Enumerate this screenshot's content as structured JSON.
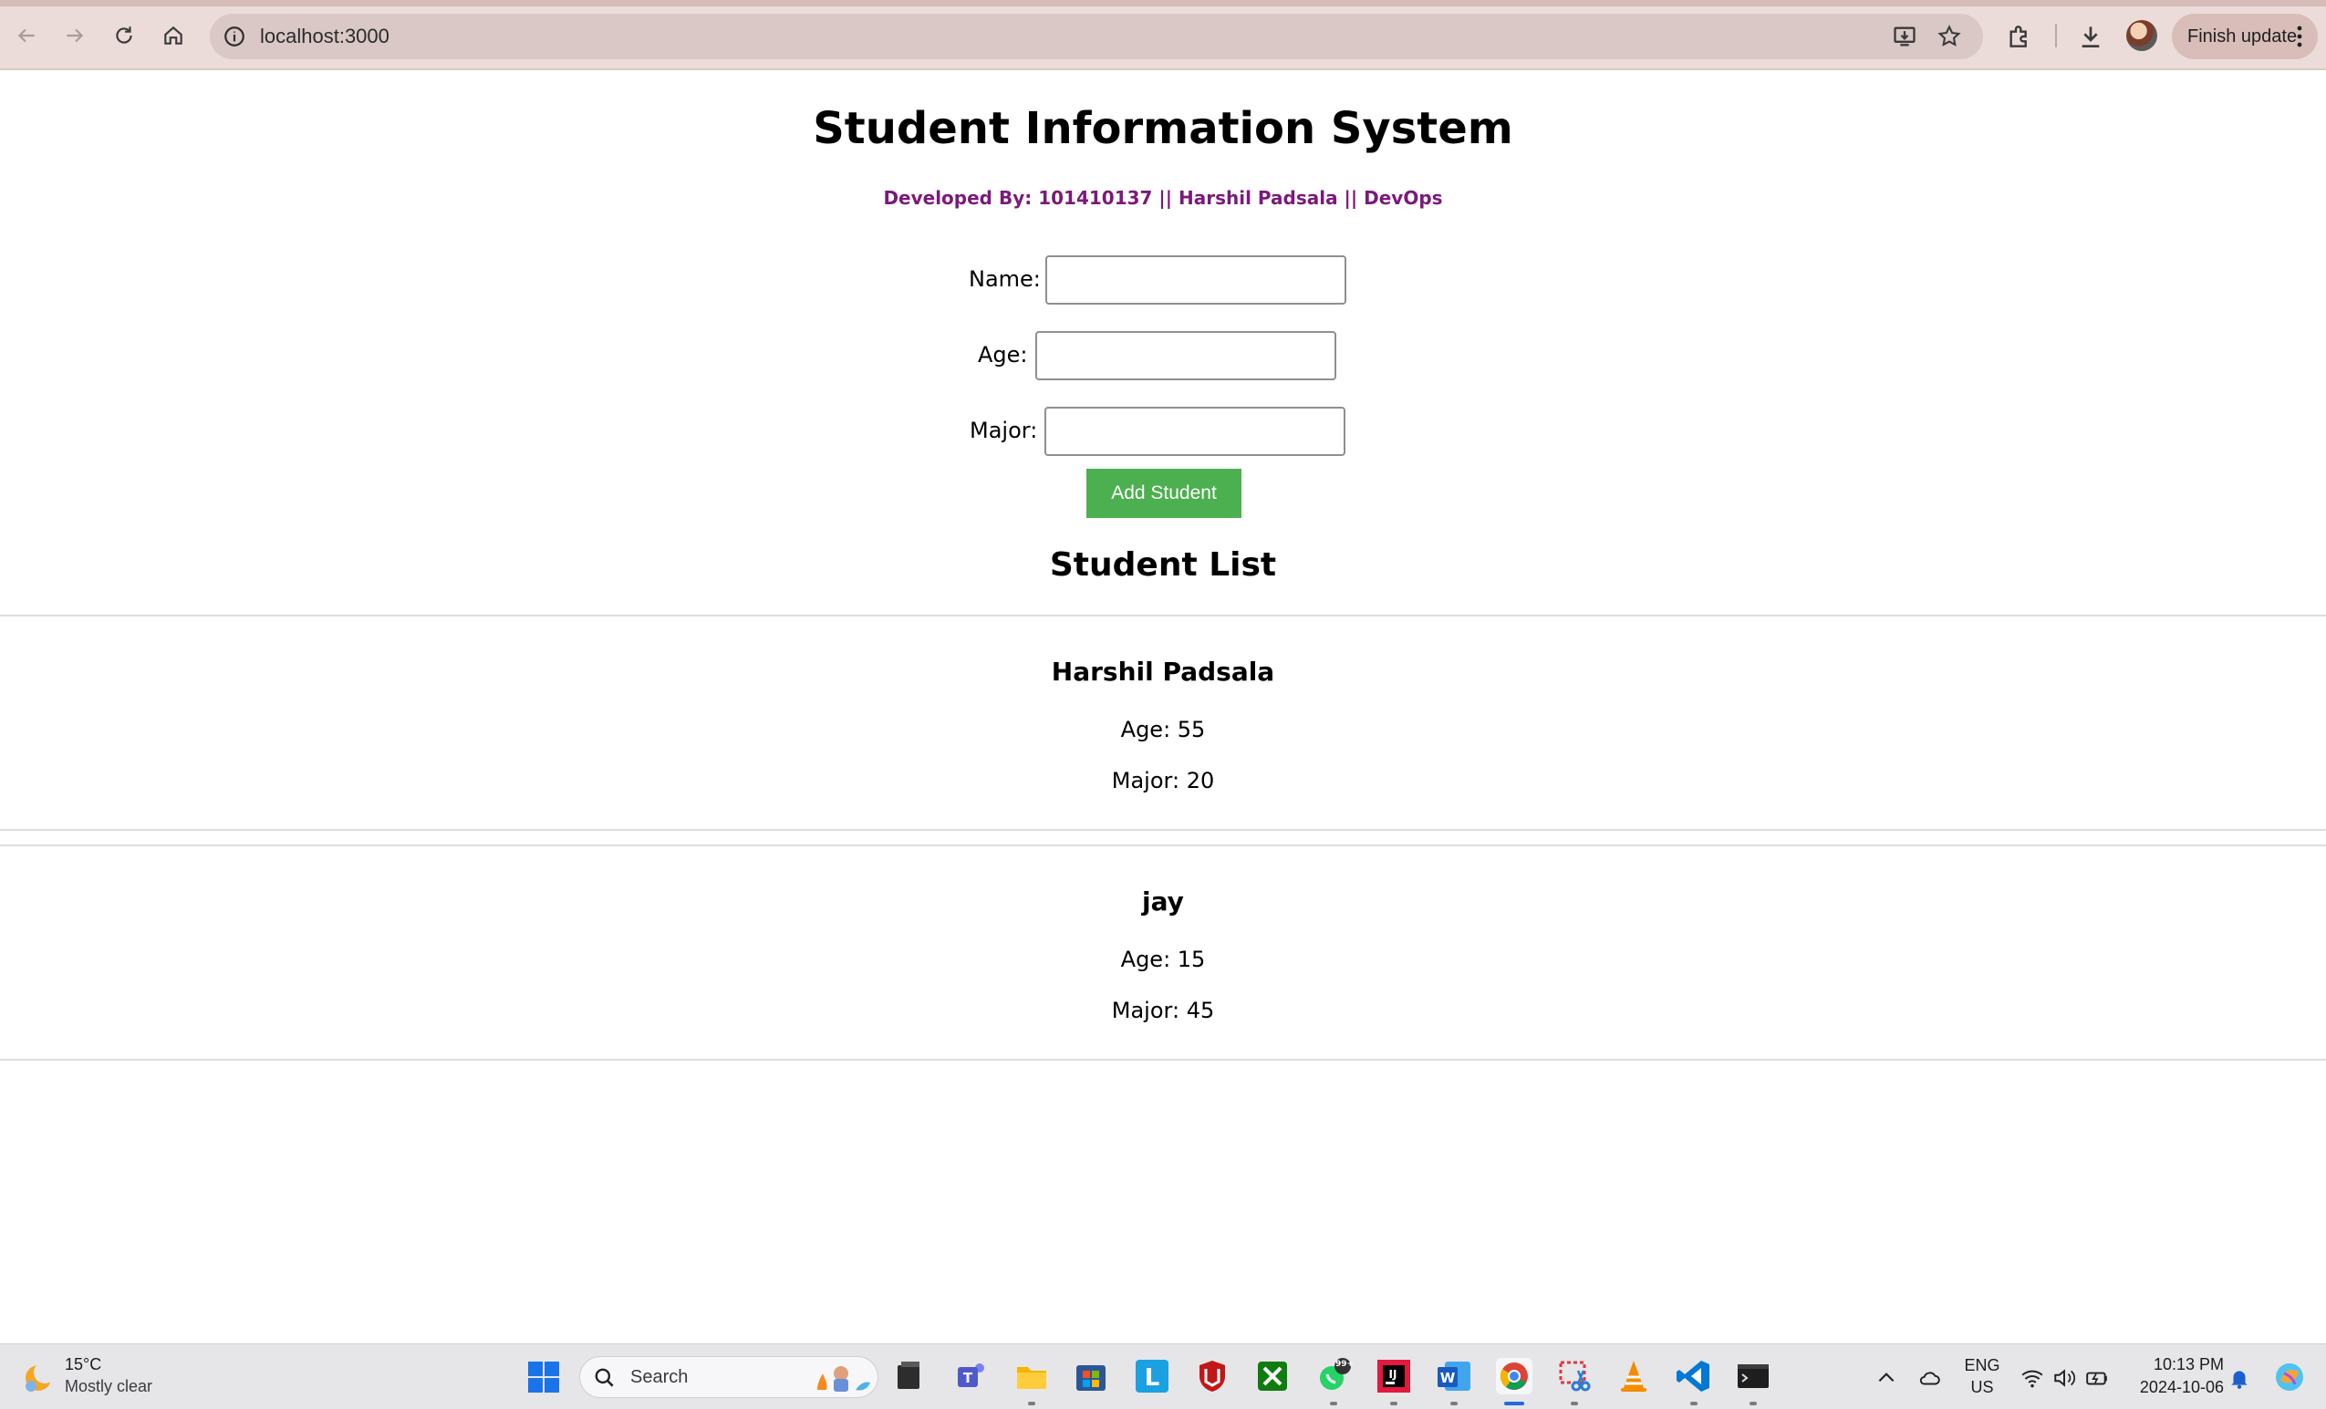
{
  "browser": {
    "url": "localhost:3000",
    "finish_update_label": "Finish update"
  },
  "page": {
    "title": "Student Information System",
    "subtitle": "Developed By: 101410137 || Harshil Padsala || DevOps",
    "form": {
      "name_label": "Name:",
      "age_label": "Age:",
      "major_label": "Major:",
      "name_value": "",
      "age_value": "",
      "major_value": "",
      "submit_label": "Add Student",
      "submit_color": "#4caf50"
    },
    "list_title": "Student List",
    "students": [
      {
        "name": "Harshil Padsala",
        "age": "Age: 55",
        "major": "Major: 20"
      },
      {
        "name": "jay",
        "age": "Age: 15",
        "major": "Major: 45"
      }
    ]
  },
  "taskbar": {
    "weather_temp": "15°C",
    "weather_desc": "Mostly clear",
    "search_placeholder": "Search",
    "whatsapp_badge": "99+",
    "lang_line1": "ENG",
    "lang_line2": "US",
    "time": "10:13 PM",
    "date": "2024-10-06",
    "apps": [
      "start-icon",
      "file-explorer-icon",
      "teams-icon",
      "folder-icon",
      "store-icon",
      "l-app-icon",
      "mcafee-icon",
      "xbox-icon",
      "whatsapp-icon",
      "intellij-icon",
      "word-icon",
      "chrome-icon",
      "snipping-tool-icon",
      "vlc-icon",
      "vscode-icon",
      "terminal-icon"
    ]
  }
}
